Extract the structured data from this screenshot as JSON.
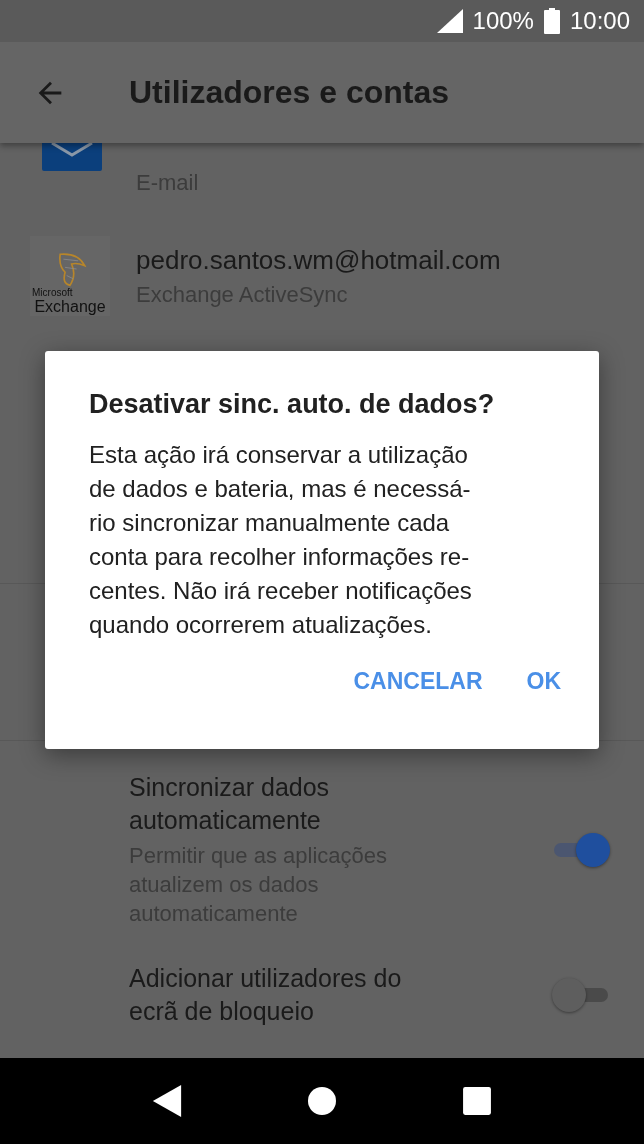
{
  "status_bar": {
    "battery": "100%",
    "time": "10:00"
  },
  "header": {
    "title": "Utilizadores e contas"
  },
  "accounts": [
    {
      "kind": "email",
      "subtitle": "E-mail"
    },
    {
      "kind": "exchange",
      "logo_brand": "Microsoft",
      "logo_name": "Exchange",
      "name": "pedro.santos.wm@hotmail.com",
      "subtitle": "Exchange ActiveSync"
    }
  ],
  "settings": [
    {
      "title": "Sincronizar dados\nautomaticamente",
      "summary": "Permitir que as aplicações\natualizem os dados\nautomaticamente",
      "on": true
    },
    {
      "title": "Adicionar utilizadores do\necrã de bloqueio",
      "on": false
    }
  ],
  "dialog": {
    "title": "Desativar sinc. auto. de dados?",
    "message": "Esta ação irá conservar a utilização\nde dados e bateria, mas é necessá-\nrio sincronizar manualmente cada\nconta para recolher informações re-\ncentes. Não irá receber notificações\nquando ocorrerem atualizações.",
    "buttons": [
      "CANCELAR",
      "OK"
    ]
  }
}
